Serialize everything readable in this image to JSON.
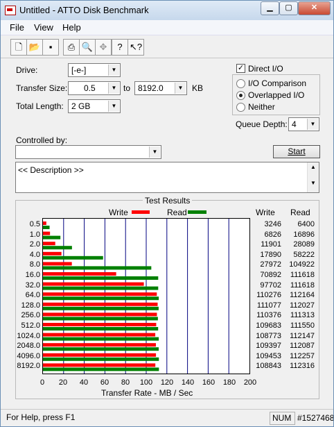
{
  "window": {
    "title": "Untitled - ATTO Disk Benchmark"
  },
  "menu": {
    "file": "File",
    "view": "View",
    "help": "Help"
  },
  "toolbar": {
    "icons": [
      "new-icon",
      "open-icon",
      "save-icon",
      "print-icon",
      "print-preview-icon",
      "move-icon",
      "help-icon",
      "context-help-icon"
    ]
  },
  "form": {
    "drive_label": "Drive:",
    "drive_value": "[-e-]",
    "transfer_size_label": "Transfer Size:",
    "transfer_from": "0.5",
    "to_label": "to",
    "transfer_to": "8192.0",
    "kb_label": "KB",
    "total_length_label": "Total Length:",
    "total_length_value": "2 GB",
    "direct_io_label": "Direct I/O",
    "direct_io_checked": true,
    "io_comparison_label": "I/O Comparison",
    "overlapped_io_label": "Overlapped I/O",
    "neither_label": "Neither",
    "queue_depth_label": "Queue Depth:",
    "queue_depth_value": "4",
    "controlled_by_label": "Controlled by:",
    "controlled_by_value": "",
    "start_label": "Start",
    "description": "<< Description >>"
  },
  "results": {
    "group_title": "Test Results",
    "legend_write": "Write",
    "legend_read": "Read",
    "write_header": "Write",
    "read_header": "Read",
    "write_color": "#ff0000",
    "read_color": "#008000",
    "rows": [
      {
        "size": "0.5",
        "write": "3246",
        "read": "6400"
      },
      {
        "size": "1.0",
        "write": "6826",
        "read": "16896"
      },
      {
        "size": "2.0",
        "write": "11901",
        "read": "28089"
      },
      {
        "size": "4.0",
        "write": "17890",
        "read": "58222"
      },
      {
        "size": "8.0",
        "write": "27972",
        "read": "104922"
      },
      {
        "size": "16.0",
        "write": "70892",
        "read": "111618"
      },
      {
        "size": "32.0",
        "write": "97702",
        "read": "111618"
      },
      {
        "size": "64.0",
        "write": "110276",
        "read": "112164"
      },
      {
        "size": "128.0",
        "write": "111077",
        "read": "112027"
      },
      {
        "size": "256.0",
        "write": "110376",
        "read": "111313"
      },
      {
        "size": "512.0",
        "write": "109683",
        "read": "111550"
      },
      {
        "size": "1024.0",
        "write": "108773",
        "read": "112147"
      },
      {
        "size": "2048.0",
        "write": "109397",
        "read": "112087"
      },
      {
        "size": "4096.0",
        "write": "109453",
        "read": "112257"
      },
      {
        "size": "8192.0",
        "write": "108843",
        "read": "112316"
      }
    ],
    "x_ticks": [
      "0",
      "20",
      "40",
      "60",
      "80",
      "100",
      "120",
      "140",
      "160",
      "180",
      "200"
    ],
    "xlabel": "Transfer Rate - MB / Sec"
  },
  "chart_data": {
    "type": "bar",
    "categories": [
      "0.5",
      "1.0",
      "2.0",
      "4.0",
      "8.0",
      "16.0",
      "32.0",
      "64.0",
      "128.0",
      "256.0",
      "512.0",
      "1024.0",
      "2048.0",
      "4096.0",
      "8192.0"
    ],
    "series": [
      {
        "name": "Write",
        "values": [
          3.246,
          6.826,
          11.901,
          17.89,
          27.972,
          70.892,
          97.702,
          110.276,
          111.077,
          110.376,
          109.683,
          108.773,
          109.397,
          109.453,
          108.843
        ]
      },
      {
        "name": "Read",
        "values": [
          6.4,
          16.896,
          28.089,
          58.222,
          104.922,
          111.618,
          111.618,
          112.164,
          112.027,
          111.313,
          111.55,
          112.147,
          112.087,
          112.257,
          112.316
        ]
      }
    ],
    "title": "Test Results",
    "xlabel": "Transfer Rate - MB / Sec",
    "xlim": [
      0,
      200
    ],
    "grid": true,
    "legend": "top"
  },
  "status": {
    "help_text": "For Help, press F1",
    "num": "NUM",
    "watermark": "#1527468"
  }
}
